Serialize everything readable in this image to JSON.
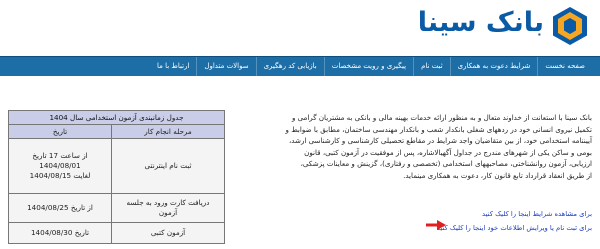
{
  "brand": {
    "name": "بانک سینا",
    "colors": {
      "blue": "#0b5aa6",
      "gold": "#f5a623",
      "nav": "#1d6ea6",
      "link": "#1a3dbf",
      "arrow": "#e02020"
    }
  },
  "nav": {
    "items": [
      {
        "label": "صفحه نخست"
      },
      {
        "label": "شرایط دعوت به همکاری"
      },
      {
        "label": "ثبت نام"
      },
      {
        "label": "پیگیری و رویت مشخصات"
      },
      {
        "label": "بازیابی کد رهگیری"
      },
      {
        "label": "سوالات متداول"
      },
      {
        "label": "ارتباط با ما"
      }
    ]
  },
  "intro": {
    "lines": [
      "بانک سینا با استعانت از خداوند متعال و به منظور ارائه خدمات بهینه مالی و بانکی به مشتریان گرامی و",
      "تکمیل نیروی انسانی خود در ردههای شغلی بانکدار شعب و بانکدار مهندسی ساختمان، مطابق با ضوابط و",
      "آییننامه استخدامی خود، از بین متقاضیان واجد شرایط در مقاطع تحصیلی کارشناسی و کارشناسی ارشد،",
      "بومی و ساکن یکی از شهرهای مندرج در جداول آگهیالاشاره، پس از موفقیت در آزمون کتبی، قانون",
      "ارزیابی، آزمون روانشناختی، مصاحبههای استخدامی (تخصصی و رفتاری)، گزینش و معاینات پزشکی،",
      "از طریق انعقاد قرارداد تابع قانون کار، دعوت به همکاری مینماید."
    ]
  },
  "links": {
    "conditions": "برای مشاهده شرایط اینجا را کلیک کنید",
    "register": "برای ثبت نام یا ویرایش اطلاعات خود اینجا را کلیک کنید"
  },
  "schedule": {
    "title": "جدول زمانبندی آزمون استخدامی سال 1404",
    "headers": {
      "step": "مرحله انجام کار",
      "date": "تاریخ"
    },
    "rows": [
      {
        "step": "ثبت نام اینترنتی",
        "date": [
          "از ساعت 17 تاریخ",
          "1404/08/01",
          "لغایت 1404/08/15"
        ]
      },
      {
        "step": [
          "دریافت کارت ورود به جلسه",
          "آزمون"
        ],
        "date": "از تاریخ 1404/08/25"
      },
      {
        "step": "آزمون کتبی",
        "date": "تاریخ 1404/08/30"
      }
    ]
  }
}
